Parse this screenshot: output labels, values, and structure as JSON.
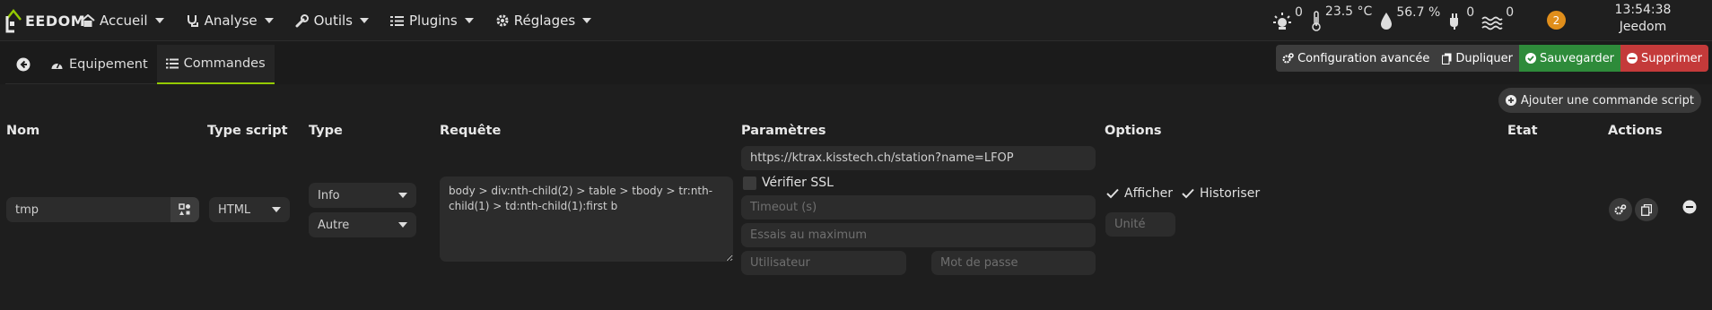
{
  "app": {
    "logo_text": "EEDOM"
  },
  "nav": {
    "accueil": "Accueil",
    "analyse": "Analyse",
    "outils": "Outils",
    "plugins": "Plugins",
    "reglages": "Réglages"
  },
  "status": {
    "light": "0",
    "temperature": "23.5 °C",
    "humidity": "56.7 %",
    "power": "0",
    "flood": "0",
    "notifications": "2",
    "time": "13:54:38",
    "hostname": "Jeedom"
  },
  "tabs": {
    "equipement": "Equipement",
    "commandes": "Commandes"
  },
  "toolbar": {
    "config": "Configuration avancée",
    "duplicate": "Dupliquer",
    "save": "Sauvegarder",
    "delete": "Supprimer",
    "add_script": "Ajouter une commande script"
  },
  "columns": {
    "nom": "Nom",
    "type_script": "Type script",
    "type": "Type",
    "requete": "Requête",
    "parametres": "Paramètres",
    "options": "Options",
    "etat": "Etat",
    "actions": "Actions"
  },
  "command": {
    "name": "tmp",
    "script_type": "HTML",
    "type": "Info",
    "subtype": "Autre",
    "request": "body > div:nth-child(2) > table > tbody > tr:nth-child(1) > td:nth-child(1):first b",
    "url": "https://ktrax.kisstech.ch/station?name=LFOP",
    "verify_ssl_label": "Vérifier SSL",
    "timeout_placeholder": "Timeout (s)",
    "max_tries_placeholder": "Essais au maximum",
    "user_placeholder": "Utilisateur",
    "password_placeholder": "Mot de passe",
    "show_label": "Afficher",
    "historize_label": "Historiser",
    "unit_placeholder": "Unité"
  },
  "colors": {
    "accent_green": "#94ca02",
    "save_green": "#2e8b3a",
    "delete_red": "#c43a3a",
    "notification_orange": "#e08e1b"
  },
  "icons": [
    "home-icon",
    "stethoscope-icon",
    "wrench-icon",
    "list-icon",
    "gear-icon",
    "light-icon",
    "thermometer-icon",
    "humidity-icon",
    "plug-icon",
    "flood-icon",
    "arrow-left-icon",
    "dashboard-icon",
    "cogs-icon",
    "copy-icon",
    "check-circle-icon",
    "minus-circle-icon",
    "plus-circle-icon",
    "config-widget-icon",
    "check-icon"
  ]
}
